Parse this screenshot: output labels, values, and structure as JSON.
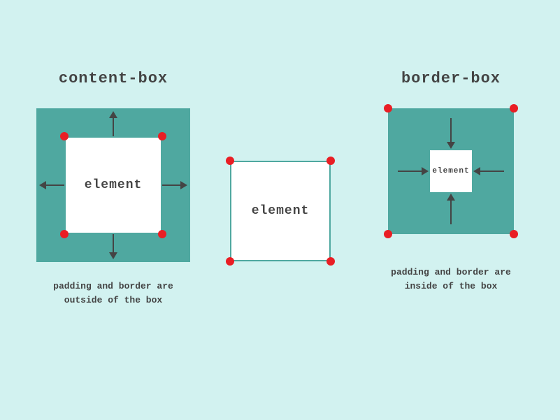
{
  "contentBox": {
    "heading": "content-box",
    "element": "element",
    "caption1": "padding and border are",
    "caption2": "outside of the box"
  },
  "middle": {
    "element": "element"
  },
  "borderBox": {
    "heading": "border-box",
    "element": "element",
    "caption1": "padding and border are",
    "caption2": "inside of the box"
  },
  "colors": {
    "teal": "#4fa8a0",
    "background": "#d2f2f0",
    "red": "#e91e24",
    "text": "#444"
  }
}
